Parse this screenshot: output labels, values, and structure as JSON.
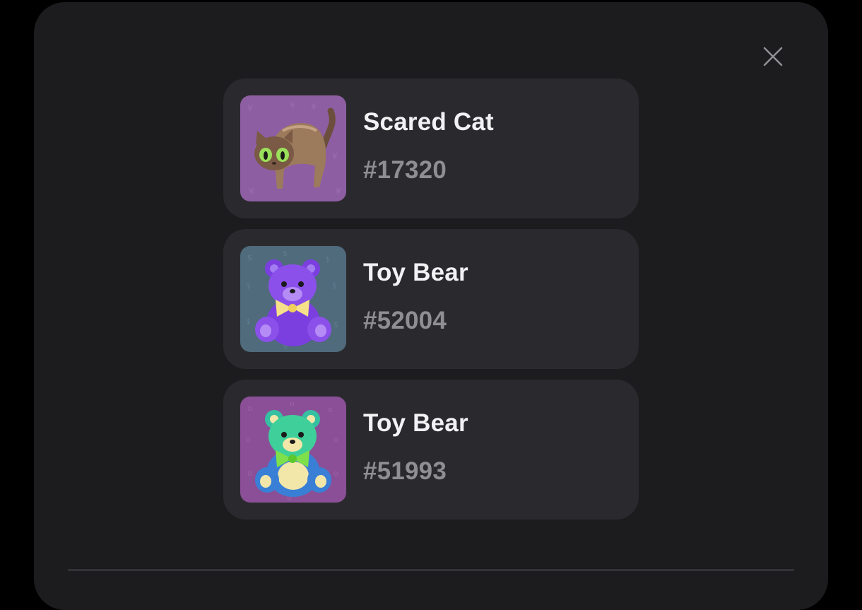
{
  "modal": {
    "close_icon": "close-icon"
  },
  "items": [
    {
      "name": "Scared Cat",
      "number": "#17320",
      "icon": "scared-cat-icon",
      "background": "#8e5ea3"
    },
    {
      "name": "Toy Bear",
      "number": "#52004",
      "icon": "purple-toy-bear-icon",
      "background": "#4f6b7c"
    },
    {
      "name": "Toy Bear",
      "number": "#51993",
      "icon": "green-toy-bear-icon",
      "background": "#8a4f96"
    }
  ]
}
